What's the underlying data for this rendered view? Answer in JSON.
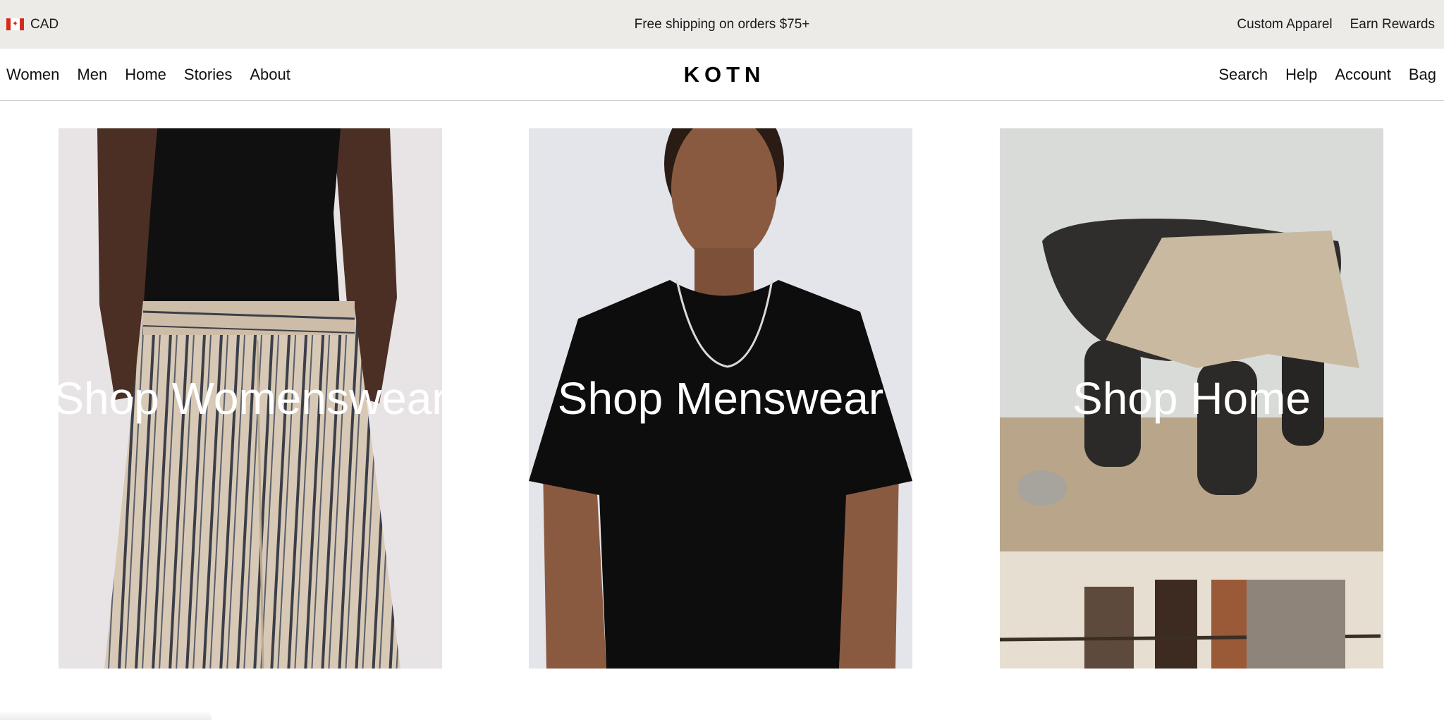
{
  "announcement": {
    "currency_flag": "canada-flag-icon",
    "currency": "CAD",
    "shipping": "Free shipping on orders $75+",
    "links": [
      "Custom Apparel",
      "Earn Rewards"
    ]
  },
  "nav": {
    "left": [
      "Women",
      "Men",
      "Home",
      "Stories",
      "About"
    ],
    "logo": "KOTN",
    "right": [
      "Search",
      "Help",
      "Account",
      "Bag"
    ]
  },
  "tiles": [
    {
      "label": "Shop Womenswear"
    },
    {
      "label": "Shop Menswear"
    },
    {
      "label": "Shop Home"
    }
  ],
  "colors": {
    "announcement_bg": "#ecebe7",
    "text": "#111111",
    "tile_label": "#ffffff"
  }
}
